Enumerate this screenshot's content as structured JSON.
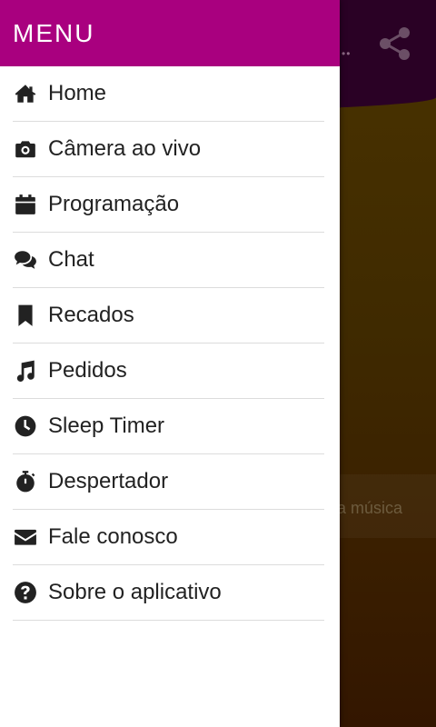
{
  "drawer": {
    "title": "MENU",
    "items": [
      {
        "label": "Home",
        "icon": "home-icon"
      },
      {
        "label": "Câmera ao vivo",
        "icon": "camera-icon"
      },
      {
        "label": "Programação",
        "icon": "calendar-icon"
      },
      {
        "label": "Chat",
        "icon": "chat-icon"
      },
      {
        "label": "Recados",
        "icon": "bookmark-icon"
      },
      {
        "label": "Pedidos",
        "icon": "music-icon"
      },
      {
        "label": "Sleep Timer",
        "icon": "clock-icon"
      },
      {
        "label": "Despertador",
        "icon": "stopwatch-icon"
      },
      {
        "label": "Fale conosco",
        "icon": "envelope-icon"
      },
      {
        "label": "Sobre o aplicativo",
        "icon": "question-icon"
      }
    ]
  },
  "background": {
    "now_playing_fragment": "a música"
  },
  "colors": {
    "drawer_header": "#a9007f",
    "app_header": "#2a0125",
    "text": "#222222"
  }
}
